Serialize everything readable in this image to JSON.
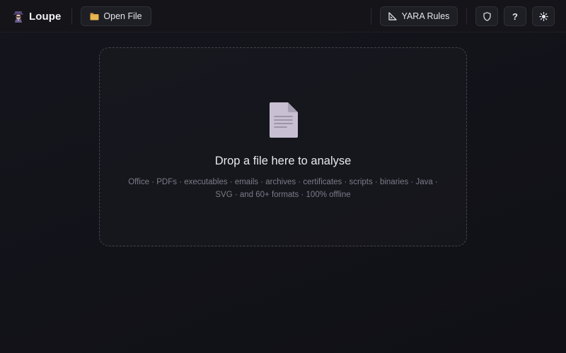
{
  "app": {
    "name": "Loupe",
    "brand_icon": "detective-icon"
  },
  "toolbar": {
    "open_file_label": "Open File",
    "open_file_icon": "folder-icon",
    "yara_label": "YARA Rules",
    "yara_icon": "triangle-ruler-icon",
    "shield_icon": "shield-icon",
    "help_label": "?",
    "theme_icon": "sun-icon"
  },
  "dropzone": {
    "icon": "document-icon",
    "title": "Drop a file here to analyse",
    "subtitle_line1": "Office · PDFs · executables · emails · archives · certificates · scripts · binaries · Java ·",
    "subtitle_line2": "SVG · and 60+ formats · 100% offline"
  },
  "colors": {
    "background": "#121219",
    "toolbar": "#141419",
    "button": "#1e1e25",
    "document_icon": "#c8c0d2",
    "folder_icon": "#d9a441"
  }
}
